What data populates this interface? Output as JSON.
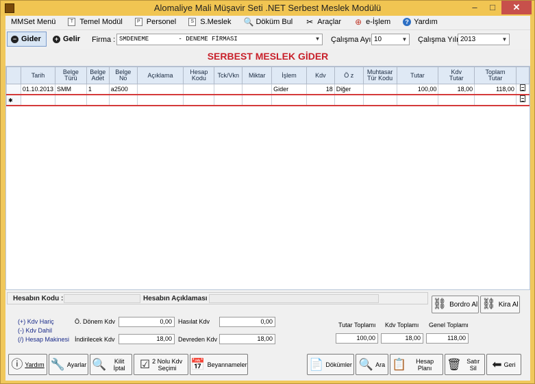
{
  "window": {
    "title": "Alomaliye Mali Müşavir Seti .NET Serbest Meslek Modülü",
    "minimize": "–",
    "maximize": "□",
    "close": "✕"
  },
  "menu": [
    {
      "label": "MMSet Menü",
      "icon": "none"
    },
    {
      "label": "Temel Modül",
      "icon": "doc-T-icon",
      "glyph": "T"
    },
    {
      "label": "Personel",
      "icon": "doc-P-icon",
      "glyph": "P"
    },
    {
      "label": "S.Meslek",
      "icon": "doc-S-icon",
      "glyph": "S"
    },
    {
      "label": "Döküm Bul",
      "icon": "magnifier-icon",
      "glyph": "🔍"
    },
    {
      "label": "Araçlar",
      "icon": "tools-icon",
      "glyph": "✂"
    },
    {
      "label": "e-İşlem",
      "icon": "globe-icon",
      "glyph": "⊕"
    },
    {
      "label": "Yardım",
      "icon": "help-icon",
      "glyph": "?"
    }
  ],
  "toolbar": {
    "gider": "Gider",
    "gelir": "Gelir",
    "firma_label": "Firma :",
    "firma_value": "SMDENEME        - DENEME FİRMASI",
    "calisma_ayi_label": "Çalışma Ayı :",
    "calisma_ayi_value": "10",
    "calisma_yili_label": "Çalışma Yılı :",
    "calisma_yili_value": "2013"
  },
  "page_title": "SERBEST MESLEK GİDER",
  "grid": {
    "columns": [
      [
        "Tarih"
      ],
      [
        "Belge",
        "Türü"
      ],
      [
        "Belge",
        "Adet"
      ],
      [
        "Belge",
        "No"
      ],
      [
        "Açıklama"
      ],
      [
        "Hesap",
        "Kodu"
      ],
      [
        "Tck/Vkn"
      ],
      [
        "Miktar"
      ],
      [
        "İşlem"
      ],
      [
        "Kdv"
      ],
      [
        "Ö z"
      ],
      [
        "Muhtasar",
        "Tür Kodu"
      ],
      [
        "Tutar"
      ],
      [
        "Kdv",
        "Tutar"
      ],
      [
        "Toplam",
        "Tutar"
      ]
    ],
    "rows": [
      [
        "01.10.2013",
        "SMM",
        "1",
        "a2500",
        "",
        "",
        "",
        "",
        "Gider",
        "18",
        "Diğer",
        "",
        "100,00",
        "18,00",
        "118,00"
      ]
    ],
    "new_row_marker": "✱"
  },
  "account": {
    "code_label": "Hesabın Kodu :",
    "desc_label": "Hesabın Açıklaması :"
  },
  "buttons_right": {
    "bordro_al": "Bordro Al",
    "kira_al": "Kira Al"
  },
  "links": {
    "kdv_haric": "(+) Kdv Hariç",
    "kdv_dahil": "(-)  Kdv Dahil",
    "hesap_makinesi": "(/) Hesap Makinesi"
  },
  "totals": {
    "o_donem_kdv_label": "Ö. Dönem Kdv",
    "o_donem_kdv": "0,00",
    "indirilecek_kdv_label": "İndirilecek Kdv",
    "indirilecek_kdv": "18,00",
    "hasilat_kdv_label": "Hasılat Kdv",
    "hasilat_kdv": "0,00",
    "devreden_kdv_label": "Devreden Kdv",
    "devreden_kdv": "18,00",
    "tutar_toplami_label": "Tutar Toplamı",
    "tutar_toplami": "100,00",
    "kdv_toplami_label": "Kdv Toplamı",
    "kdv_toplami": "18,00",
    "genel_toplami_label": "Genel Toplamı",
    "genel_toplami": "118,00"
  },
  "bottom_buttons": {
    "yardim": "Yardım",
    "ayarlar": "Ayarlar",
    "kilit_iptal": "Kilit İptal",
    "nolu_kdv_1": "2 Nolu Kdv",
    "nolu_kdv_2": "Seçimi",
    "beyannameler": "Beyannameler",
    "dokumler": "Dökümler",
    "ara": "Ara",
    "hesap_plani": "Hesap Planı",
    "satir_sil": "Satır Sil",
    "geri": "Geri"
  }
}
